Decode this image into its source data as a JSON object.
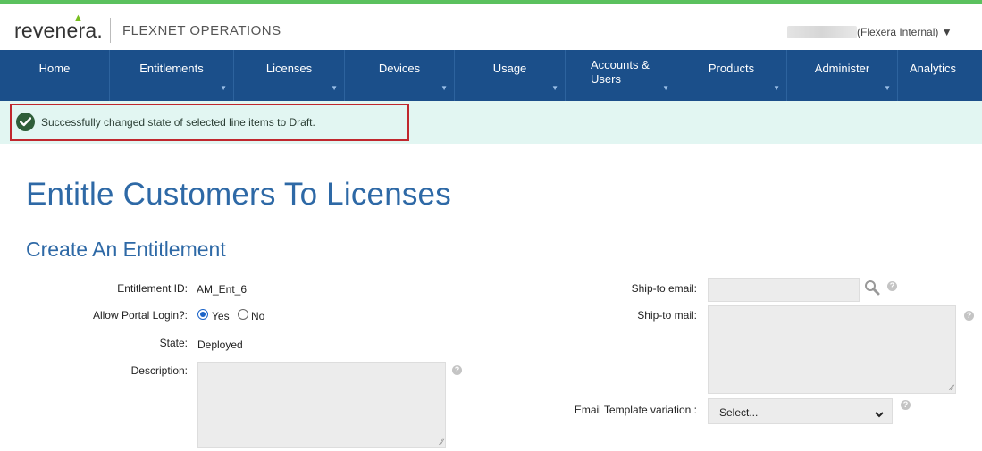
{
  "header": {
    "logo_text": "revenera.",
    "product_name": "FLEXNET OPERATIONS",
    "user_label": "(Flexera Internal) ▼"
  },
  "nav": {
    "items": [
      {
        "label": "Home",
        "has_dropdown": false
      },
      {
        "label": "Entitlements",
        "has_dropdown": true
      },
      {
        "label": "Licenses",
        "has_dropdown": true
      },
      {
        "label": "Devices",
        "has_dropdown": true
      },
      {
        "label": "Usage",
        "has_dropdown": true
      },
      {
        "label": "Accounts &",
        "label2": "Users",
        "has_dropdown": true
      },
      {
        "label": "Products",
        "has_dropdown": true
      },
      {
        "label": "Administer",
        "has_dropdown": true
      },
      {
        "label": "Analytics",
        "has_dropdown": false
      }
    ]
  },
  "alert": {
    "message": "Successfully changed state of selected line items to Draft.",
    "icon": "check-circle-icon"
  },
  "page": {
    "title": "Entitle Customers To Licenses",
    "section_title": "Create An Entitlement"
  },
  "form": {
    "entitlement_id_label": "Entitlement ID:",
    "entitlement_id_value": "AM_Ent_6",
    "allow_portal_label": "Allow Portal Login?:",
    "yes_label": "Yes",
    "no_label": "No",
    "allow_portal_selected": "Yes",
    "state_label": "State:",
    "state_value": "Deployed",
    "description_label": "Description:",
    "description_value": "",
    "ship_to_email_label": "Ship-to email:",
    "ship_to_email_value": "",
    "ship_to_mail_label": "Ship-to mail:",
    "ship_to_mail_value": "",
    "email_template_label": "Email Template variation :",
    "email_template_value": "Select..."
  },
  "colors": {
    "accent_green": "#5bc15e",
    "nav_blue": "#1b4f8a",
    "title_blue": "#2e69a6",
    "alert_bg": "#e2f6f2",
    "highlight_red": "#c0272d"
  }
}
